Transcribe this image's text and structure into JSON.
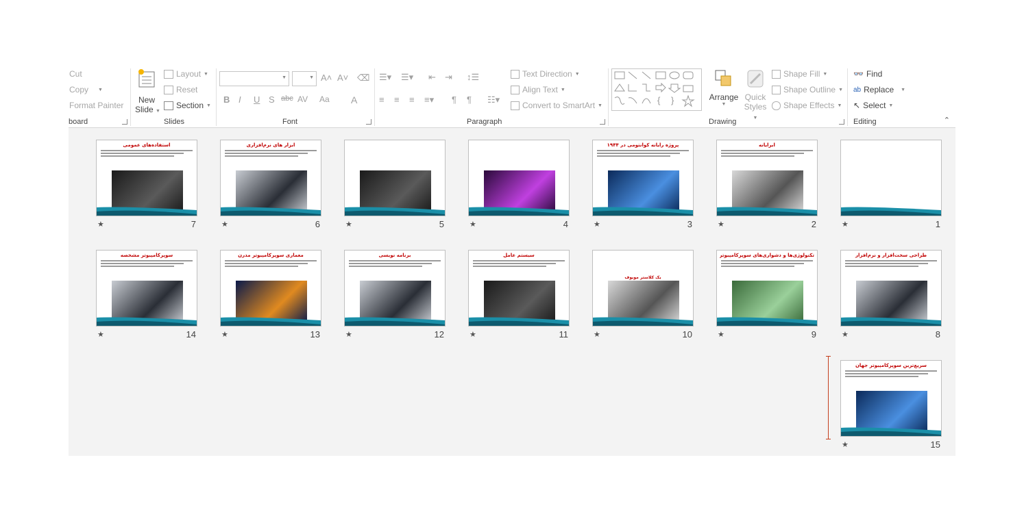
{
  "ribbon": {
    "clipboard": {
      "cut": "Cut",
      "copy": "Copy",
      "format_painter": "Format Painter",
      "label": "board"
    },
    "slides": {
      "new_slide": "New",
      "new_slide2": "Slide",
      "layout": "Layout",
      "reset": "Reset",
      "section": "Section",
      "label": "Slides"
    },
    "font": {
      "label": "Font",
      "bold": "B",
      "italic": "I",
      "underline": "U",
      "shadow": "S",
      "strike": "abc",
      "spacing": "AV",
      "case": "Aa",
      "color": "A"
    },
    "paragraph": {
      "label": "Paragraph",
      "text_direction": "Text Direction",
      "align_text": "Align Text",
      "convert_smartart": "Convert to SmartArt"
    },
    "drawing": {
      "label": "Drawing",
      "arrange": "Arrange",
      "quick_styles": "Quick",
      "quick_styles2": "Styles",
      "shape_fill": "Shape Fill",
      "shape_outline": "Shape Outline",
      "shape_effects": "Shape Effects"
    },
    "editing": {
      "label": "Editing",
      "find": "Find",
      "replace": "Replace",
      "select": "Select"
    }
  },
  "slides": [
    {
      "num": "1",
      "title": "",
      "pic": "none"
    },
    {
      "num": "2",
      "title": "ابرایانه",
      "pic": "gray"
    },
    {
      "num": "3",
      "title": "پروژه رایانه کوانتومی در ۱۹۴۴",
      "pic": "blue"
    },
    {
      "num": "4",
      "title": "",
      "pic": "purple"
    },
    {
      "num": "5",
      "title": "",
      "pic": "dark"
    },
    {
      "num": "6",
      "title": "ابزار های نرم‌افزاری",
      "pic": "light"
    },
    {
      "num": "7",
      "title": "استفاده‌های عمومی",
      "pic": "dark"
    },
    {
      "num": "8",
      "title": "طراحی سخت‌افزار و نرم‌افزار",
      "pic": "light"
    },
    {
      "num": "9",
      "title": "تکنولوژی‌ها و دشواری‌های سوپرکامپیوترها",
      "pic": "green"
    },
    {
      "num": "10",
      "title": "",
      "pic": "gray"
    },
    {
      "num": "11",
      "title": "سیستم عامل",
      "pic": "dark"
    },
    {
      "num": "12",
      "title": "برنامه نویسی",
      "pic": "light"
    },
    {
      "num": "13",
      "title": "معماری سوپرکامپیوتر مدرن",
      "pic": "orange"
    },
    {
      "num": "14",
      "title": "سوپرکامپیوتر مشخصه",
      "pic": "light"
    },
    {
      "num": "15",
      "title": "سریع‌ترین سوپرکامپیوتر جهان",
      "pic": "blue"
    }
  ],
  "labels": {
    "slide10_sub": "یک کلاستر مویوف"
  },
  "colors": {
    "accent": "#c43e1c",
    "title_red": "#c00000",
    "teal": "#1a8fa8"
  }
}
